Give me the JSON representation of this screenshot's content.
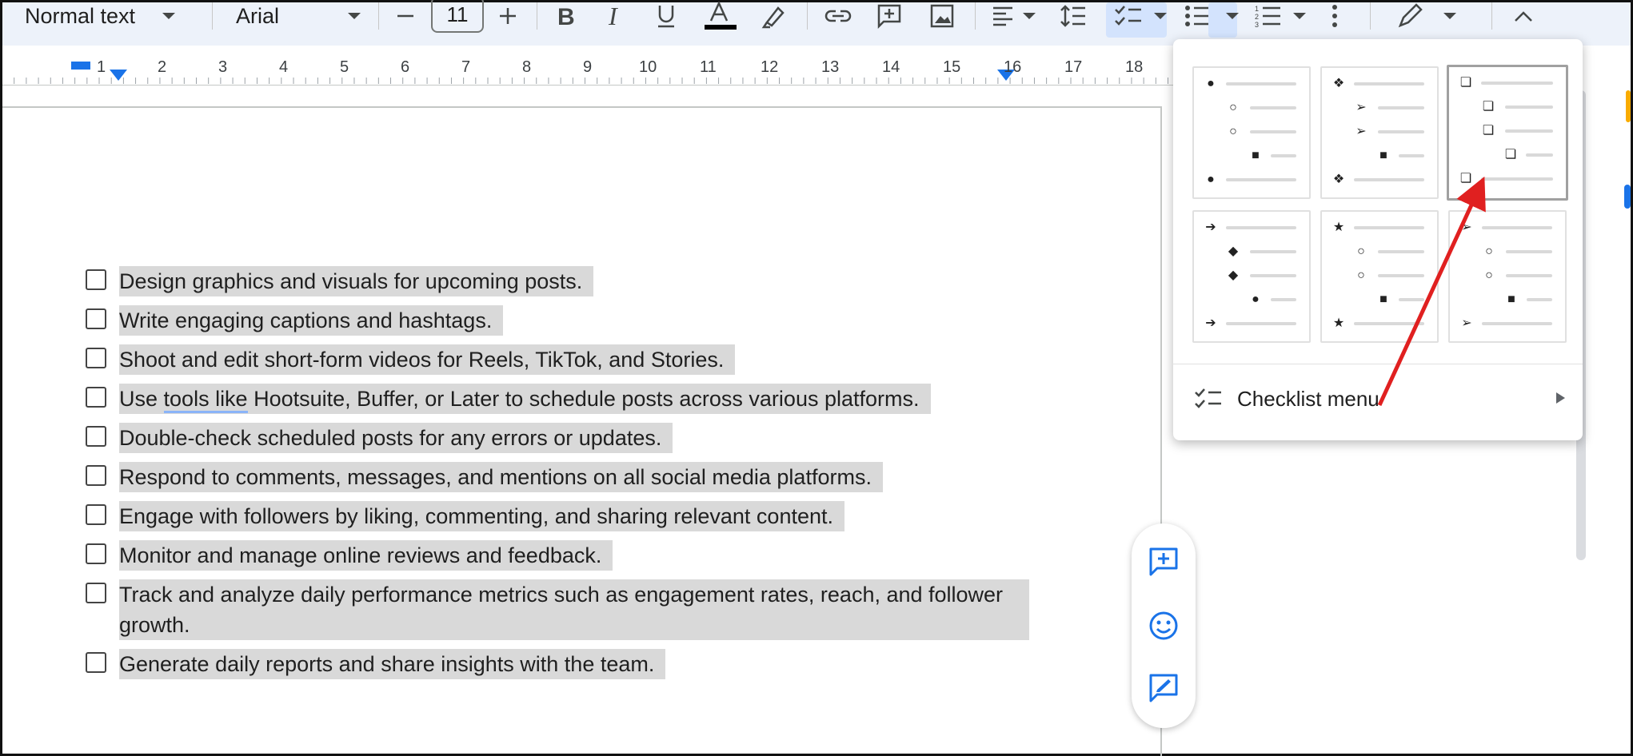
{
  "toolbar": {
    "style_select": "Normal text",
    "font_select": "Arial",
    "font_size": "11"
  },
  "ruler": {
    "numbers": [
      "1",
      "2",
      "3",
      "4",
      "5",
      "6",
      "7",
      "8",
      "9",
      "10",
      "11",
      "12",
      "13",
      "14",
      "15",
      "16",
      "17",
      "18"
    ]
  },
  "checklist": {
    "items": [
      "Design graphics and visuals for upcoming posts.",
      "Write engaging captions and hashtags.",
      "Shoot and edit short-form videos for Reels, TikTok, and Stories.",
      "Double-check scheduled posts for any errors or updates.",
      "Respond to comments, messages, and mentions on all social media platforms.",
      "Engage with followers by liking, commenting, and sharing relevant content.",
      "Monitor and manage online reviews and feedback.",
      "Track and analyze daily performance metrics such as engagement rates, reach, and follower growth.",
      "Generate daily reports and share insights with the team."
    ],
    "item4_prefix": "Use ",
    "item4_underlined": "tools like",
    "item4_suffix": " Hootsuite, Buffer, or Later to schedule posts across various platforms."
  },
  "menu": {
    "checklist_menu_label": "Checklist menu",
    "styles": [
      {
        "name": "bullet-style-1",
        "glyphs": [
          "●",
          "○",
          "○",
          "■",
          "●"
        ]
      },
      {
        "name": "bullet-style-2",
        "glyphs": [
          "❖",
          "➢",
          "➢",
          "■",
          "❖"
        ]
      },
      {
        "name": "checkbox-style",
        "glyphs": [
          "❏",
          "❏",
          "❏",
          "❏",
          "❏"
        ],
        "selected": true
      },
      {
        "name": "bullet-style-4",
        "glyphs": [
          "➔",
          "◆",
          "◆",
          "●",
          "➔"
        ]
      },
      {
        "name": "bullet-style-5",
        "glyphs": [
          "★",
          "○",
          "○",
          "■",
          "★"
        ]
      },
      {
        "name": "bullet-style-6",
        "glyphs": [
          "➢",
          "○",
          "○",
          "■",
          "➢"
        ]
      }
    ]
  },
  "colors": {
    "annotation_arrow": "#e02020",
    "selection_highlight": "#d9d9d9",
    "toolbar_bg": "#edf2fa",
    "accent_blue": "#1a73e8"
  }
}
